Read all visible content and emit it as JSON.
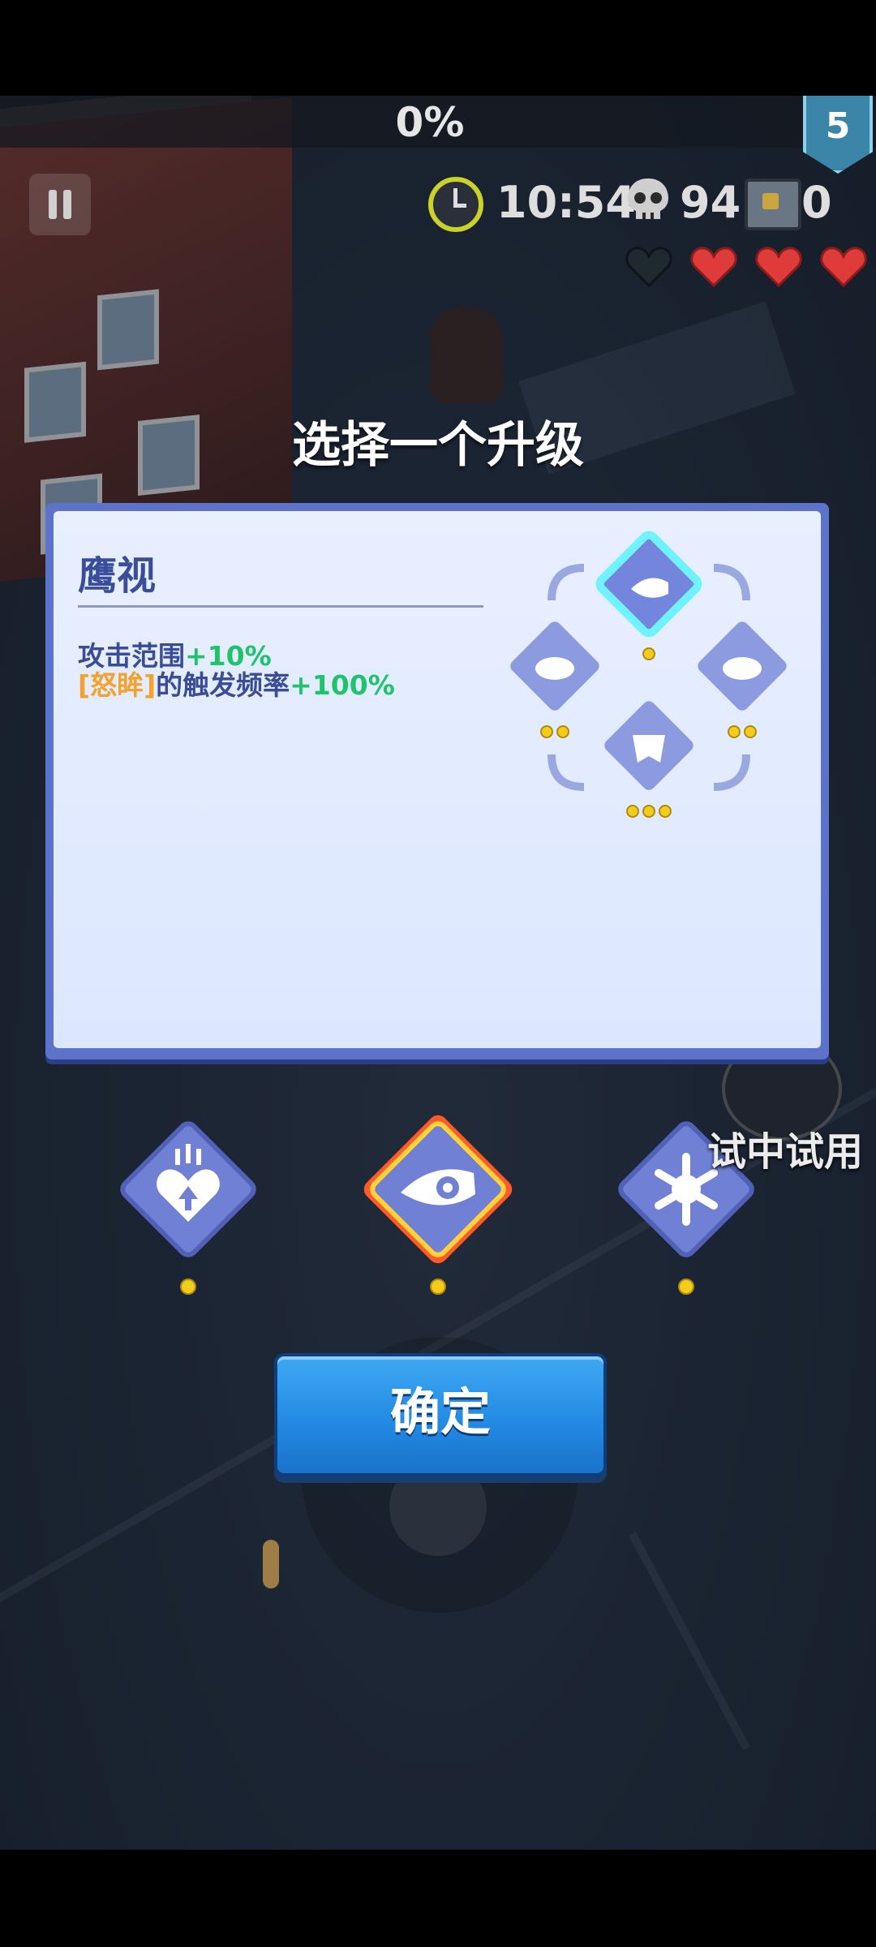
{
  "hud": {
    "progress_percent": "0%",
    "level": "5",
    "timer": "10:54",
    "kills": "94",
    "chests": "0",
    "hearts": {
      "filled": 3,
      "empty": 1
    }
  },
  "title": "选择一个升级",
  "skill_detail": {
    "name": "鹰视",
    "line1_text": "攻击范围",
    "line1_value": "+10%",
    "line2_tag": "[怒眸]",
    "line2_text": "的触发频率",
    "line2_value": "+100%",
    "tree": [
      {
        "icon": "cannon-eye-icon",
        "level_dots": 1,
        "selected": true
      },
      {
        "icon": "flame-eye-icon",
        "level_dots": 2,
        "selected": false
      },
      {
        "icon": "burning-eye-icon",
        "level_dots": 2,
        "selected": false
      },
      {
        "icon": "demon-eye-icon",
        "level_dots": 3,
        "selected": false
      }
    ]
  },
  "choices": [
    {
      "icon": "heart-upgrade-icon",
      "level_dots": 1,
      "selected": false
    },
    {
      "icon": "cannon-eye-icon",
      "level_dots": 1,
      "selected": true
    },
    {
      "icon": "snowflake-fist-icon",
      "level_dots": 1,
      "selected": false
    }
  ],
  "confirm_label": "确定",
  "trial_label": "试中试用",
  "colors": {
    "panel_border": "#5d72c9",
    "panel_bg": "#e8efff",
    "skill_text": "#3b4c96",
    "bonus_green": "#1fc46a",
    "tag_orange": "#f2a22d",
    "confirm_blue": "#2288e2",
    "diamond": "#7080d4",
    "dot_yellow": "#f4cc1a"
  }
}
